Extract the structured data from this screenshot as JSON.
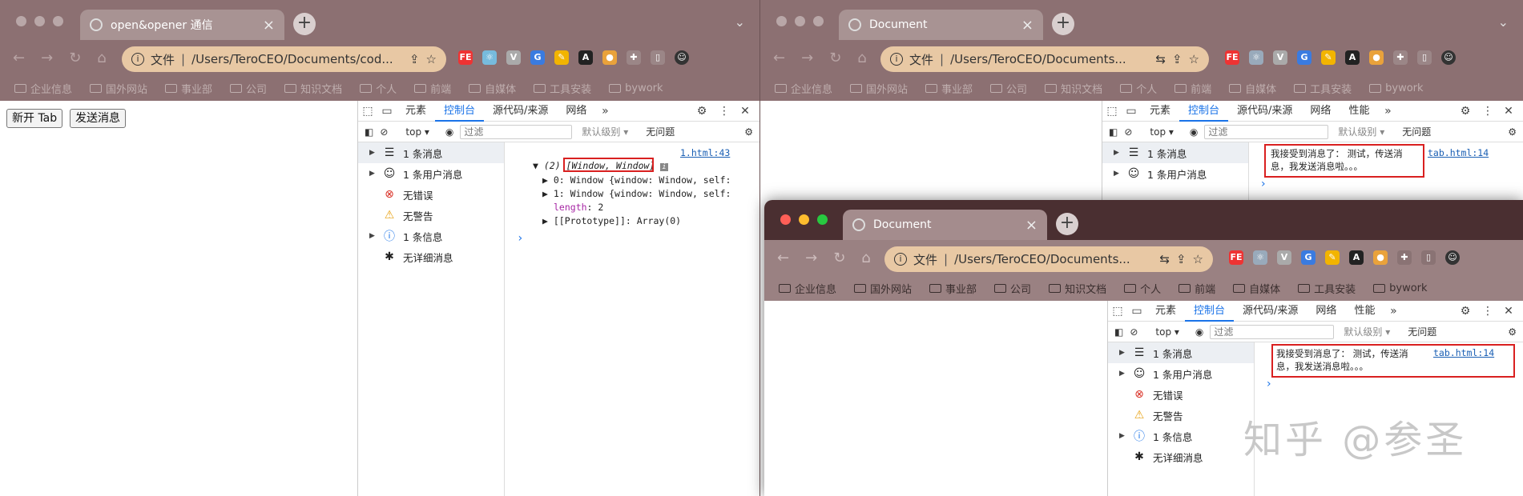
{
  "left_window": {
    "tab_title": "open&opener 通信",
    "url_prefix": "文件",
    "url": "/Users/TeroCEO/Documents/cod...",
    "bookmarks": [
      "企业信息",
      "国外网站",
      "事业部",
      "公司",
      "知识文档",
      "个人",
      "前端",
      "自媒体",
      "工具安装",
      "bywork"
    ],
    "page_buttons": [
      "新开 Tab",
      "发送消息"
    ],
    "devtools": {
      "tabs": [
        "元素",
        "控制台",
        "源代码/来源",
        "网络"
      ],
      "context": "top",
      "filter_placeholder": "过滤",
      "level": "默认级别",
      "issues": "无问题",
      "sidebar": [
        "1 条消息",
        "1 条用户消息",
        "无错误",
        "无警告",
        "1 条信息",
        "无详细消息"
      ],
      "source_link": "1.html:43",
      "log_head_count": "(2)",
      "log_head_value": "[Window, Window]",
      "log_lines": [
        "0: Window {window: Window, self:",
        "1: Window {window: Window, self:"
      ],
      "length_key": "length",
      "length_value": "2",
      "proto_line": "[[Prototype]]: Array(0)",
      "prompt": "›"
    }
  },
  "right_back_window": {
    "tab_title": "Document",
    "url_prefix": "文件",
    "url": "/Users/TeroCEO/Documents...",
    "bookmarks": [
      "企业信息",
      "国外网站",
      "事业部",
      "公司",
      "知识文档",
      "个人",
      "前端",
      "自媒体",
      "工具安装",
      "bywork"
    ],
    "devtools": {
      "tabs": [
        "元素",
        "控制台",
        "源代码/来源",
        "网络",
        "性能"
      ],
      "context": "top",
      "filter_placeholder": "过滤",
      "level": "默认级别",
      "issues": "无问题",
      "sidebar": [
        "1 条消息",
        "1 条用户消息"
      ],
      "message": "我接受到消息了： 测试，传送消息，我发送消息啦。。。",
      "source_link": "tab.html:14"
    }
  },
  "right_front_window": {
    "tab_title": "Document",
    "url_prefix": "文件",
    "url": "/Users/TeroCEO/Documents...",
    "bookmarks": [
      "企业信息",
      "国外网站",
      "事业部",
      "公司",
      "知识文档",
      "个人",
      "前端",
      "自媒体",
      "工具安装",
      "bywork"
    ],
    "devtools": {
      "tabs": [
        "元素",
        "控制台",
        "源代码/来源",
        "网络",
        "性能"
      ],
      "context": "top",
      "filter_placeholder": "过滤",
      "level": "默认级别",
      "issues": "无问题",
      "sidebar": [
        "1 条消息",
        "1 条用户消息",
        "无错误",
        "无警告",
        "1 条信息",
        "无详细消息"
      ],
      "message": "我接受到消息了： 测试，传送消息，我发送消息啦。。。",
      "source_link": "tab.html:14"
    }
  },
  "watermark": "知乎 @参圣",
  "colors": {
    "accent": "#1a73e8",
    "highlight_box": "#d92020"
  }
}
